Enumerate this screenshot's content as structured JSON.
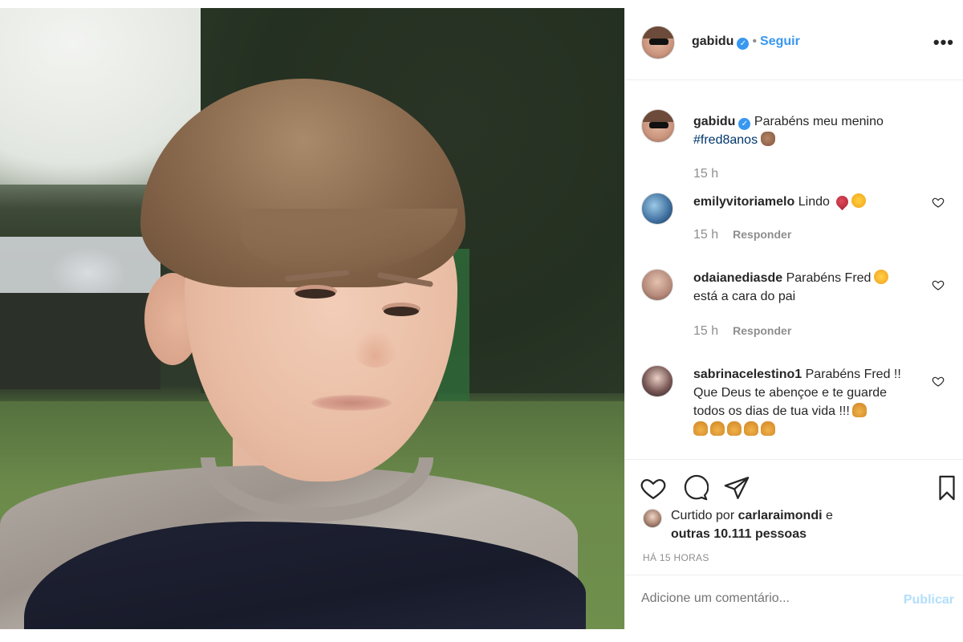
{
  "post": {
    "author": "gabidu",
    "follow_label": "Seguir",
    "separator": "•",
    "more_label": "•••",
    "caption": {
      "username": "gabidu",
      "text": "Parabéns meu menino",
      "hashtag": "#fred8anos",
      "time": "15 h"
    },
    "comments": [
      {
        "username": "emilyvitoriamelo",
        "text": "Lindo",
        "time": "15 h",
        "reply_label": "Responder"
      },
      {
        "username": "odaianediasde",
        "text": "Parabéns Fred",
        "text2": "está a cara do pai",
        "time": "15 h",
        "reply_label": "Responder"
      },
      {
        "username": "sabrinacelestino1",
        "text": "Parabéns Fred !!",
        "text2": "Que Deus te abençoe e te guarde",
        "text3": "todos os dias de tua vida !!!"
      }
    ],
    "likes": {
      "prefix": "Curtido por",
      "user": "carlaraimondi",
      "connector": "e",
      "others": "outras 10.111 pessoas"
    },
    "timestamp": "HÁ 15 HORAS",
    "add_comment_placeholder": "Adicione um comentário...",
    "publish_label": "Publicar"
  },
  "icons": {
    "verified": "verified-badge-icon",
    "like": "heart-icon",
    "comment": "comment-icon",
    "share": "share-icon",
    "save": "bookmark-icon",
    "more": "more-icon"
  },
  "colors": {
    "accent": "#3897f0",
    "link": "#00376b",
    "muted": "#8e8e8e",
    "publish_disabled": "#b2dffc"
  }
}
